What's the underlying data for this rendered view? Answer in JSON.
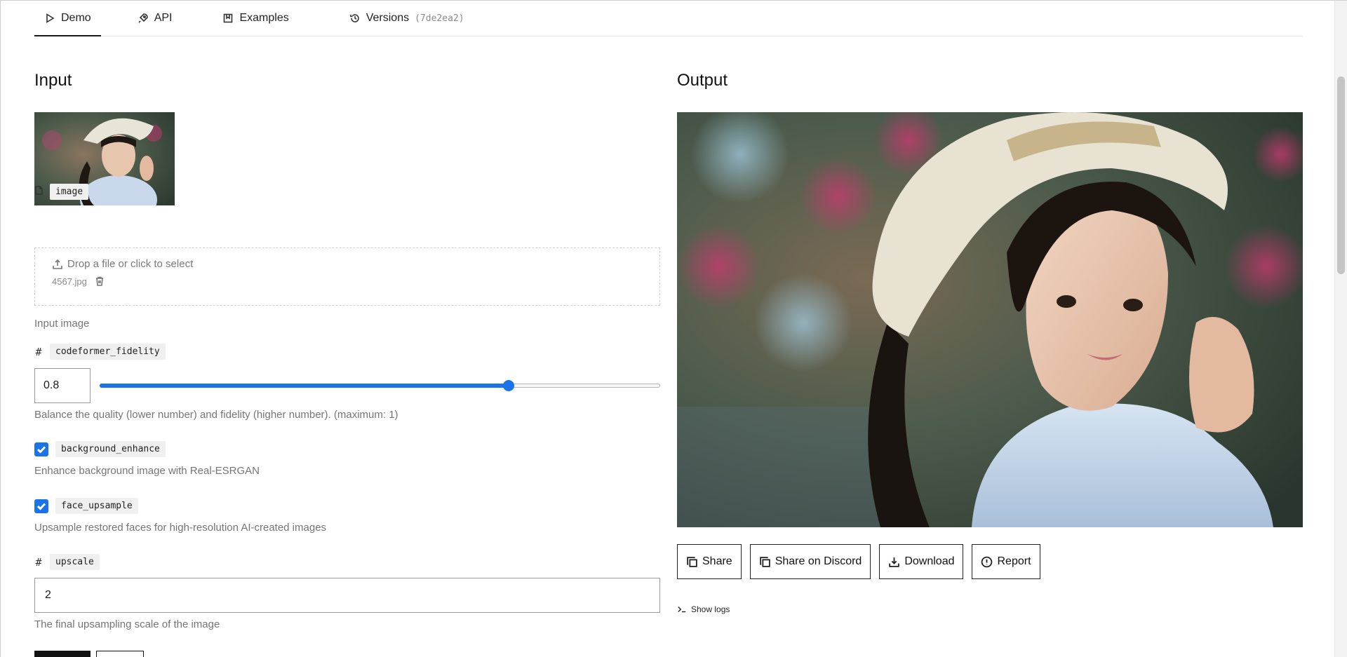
{
  "tabs": [
    {
      "label": "Demo",
      "icon": "play-icon",
      "active": true
    },
    {
      "label": "API",
      "icon": "rocket-icon"
    },
    {
      "label": "Examples",
      "icon": "bookmark-icon"
    },
    {
      "label": "Versions",
      "icon": "history-icon",
      "hash": "(7de2ea2)"
    }
  ],
  "input": {
    "title": "Input",
    "image_field": {
      "name": "image",
      "dropzone_text": "Drop a file or click to select",
      "filename": "4567.jpg",
      "help": "Input image"
    },
    "fidelity_field": {
      "type_symbol": "#",
      "name": "codeformer_fidelity",
      "value": "0.8",
      "slider_fraction": 0.8,
      "help": "Balance the quality (lower number) and fidelity (higher number). (maximum: 1)"
    },
    "background_field": {
      "name": "background_enhance",
      "checked": true,
      "help": "Enhance background image with Real-ESRGAN"
    },
    "face_field": {
      "name": "face_upsample",
      "checked": true,
      "help": "Upsample restored faces for high-resolution AI-created images"
    },
    "upscale_field": {
      "type_symbol": "#",
      "name": "upscale",
      "value": "2",
      "help": "The final upsampling scale of the image"
    }
  },
  "output": {
    "title": "Output",
    "buttons": {
      "share": "Share",
      "discord": "Share on Discord",
      "download": "Download",
      "report": "Report"
    },
    "logs_label": "Show logs"
  },
  "colors": {
    "accent": "#1a73e8",
    "text": "#1a1a1a",
    "muted": "#757575"
  }
}
